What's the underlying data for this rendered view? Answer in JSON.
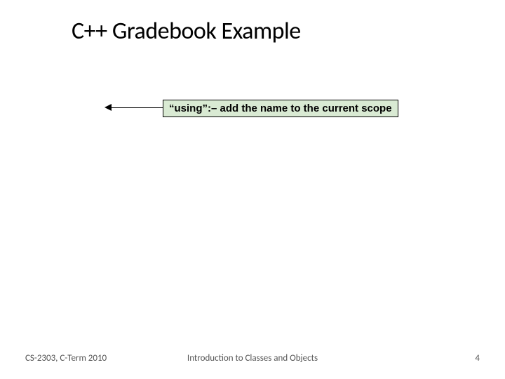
{
  "title": "C++ Gradebook Example",
  "callout": "“using”:– add the name to the current scope",
  "footer": {
    "left": "CS-2303, C-Term 2010",
    "center": "Introduction to Classes and Objects",
    "page_number": "4"
  }
}
